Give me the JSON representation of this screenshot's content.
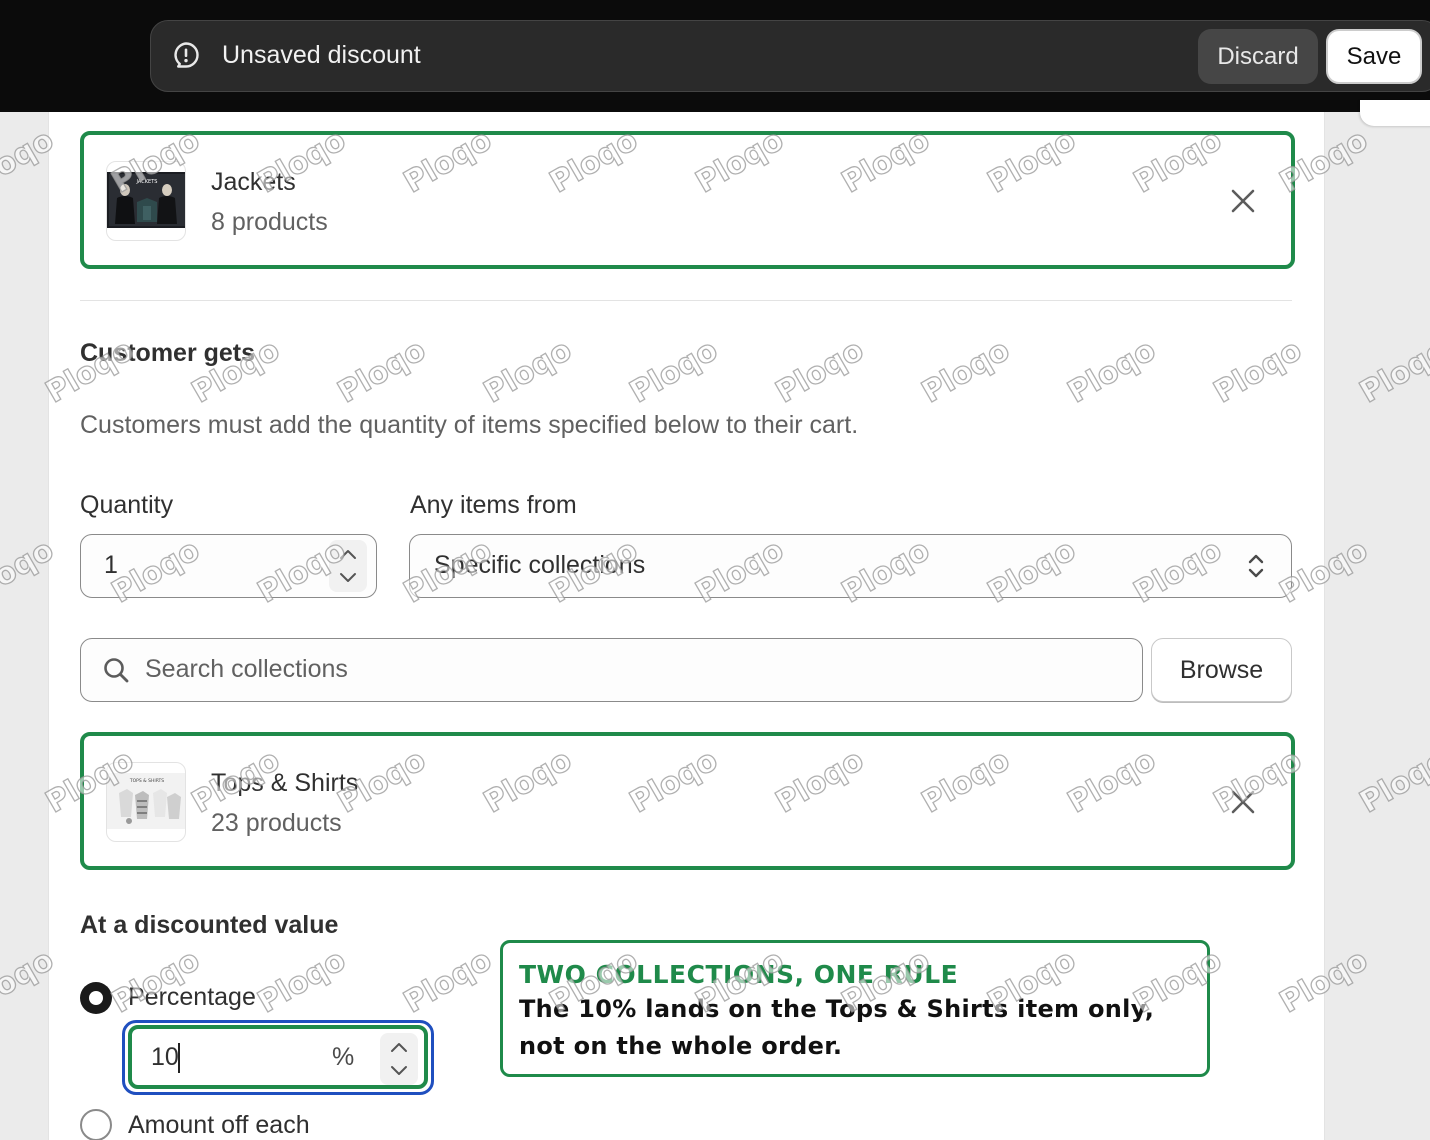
{
  "savebar": {
    "title": "Unsaved discount",
    "discard_label": "Discard",
    "save_label": "Save",
    "icon": "alert-circle-icon"
  },
  "buys_collection": {
    "name": "Jackets",
    "count": "8 products",
    "thumb_text": "JACKETS"
  },
  "customer_gets": {
    "heading": "Customer gets",
    "help": "Customers must add the quantity of items specified below to their cart.",
    "quantity_label": "Quantity",
    "quantity_value": "1",
    "any_items_label": "Any items from",
    "any_items_value": "Specific collections",
    "search_placeholder": "Search collections",
    "browse_label": "Browse",
    "collection": {
      "name": "Tops & Shirts",
      "count": "23 products",
      "thumb_text": "TOPS & SHIRTS"
    }
  },
  "discounted_value": {
    "heading": "At a discounted value",
    "option_percentage": "Percentage",
    "percentage_value": "10",
    "percent_suffix": "%",
    "option_amount": "Amount off each"
  },
  "annotation": {
    "title": "TWO COLLECTIONS, ONE RULE",
    "line1": "The 10% lands on the Tops & Shirts item only,",
    "line2": "not on the whole order."
  },
  "watermark": "Ploqo",
  "colors": {
    "highlight_green": "#1f8a4a",
    "focus_blue": "#1f4fbf",
    "topbar": "#0b0b0b"
  }
}
